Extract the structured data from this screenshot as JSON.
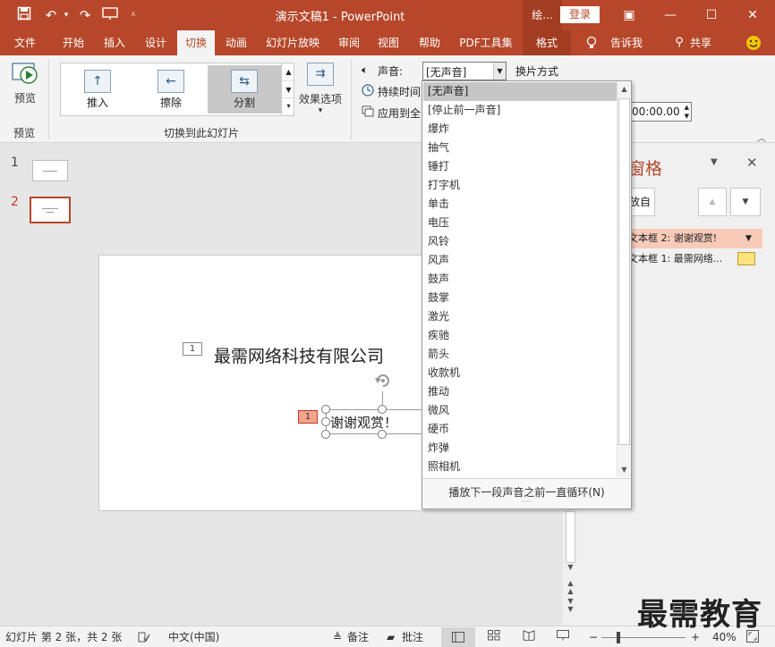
{
  "titlebar": {
    "title": "演示文稿1  -  PowerPoint",
    "context_tab": "绘...",
    "login": "登录",
    "save_icon": "save-icon",
    "undo_icon": "undo-icon",
    "redo_icon": "redo-icon",
    "minimize": "—",
    "maximize": "☐",
    "close": "✕",
    "ribbon_display": "▣"
  },
  "tabs": [
    {
      "label": "文件"
    },
    {
      "label": "开始"
    },
    {
      "label": "插入"
    },
    {
      "label": "设计"
    },
    {
      "label": "切换"
    },
    {
      "label": "动画"
    },
    {
      "label": "幻灯片放映"
    },
    {
      "label": "审阅"
    },
    {
      "label": "视图"
    },
    {
      "label": "帮助"
    },
    {
      "label": "PDF工具集"
    },
    {
      "label": "格式"
    },
    {
      "label": "告诉我"
    },
    {
      "label": "共享"
    }
  ],
  "ribbon": {
    "preview_label": "预览",
    "preview_group": "预览",
    "gallery_items": [
      {
        "label": "推入",
        "glyph": "↑"
      },
      {
        "label": "擦除",
        "glyph": "←"
      },
      {
        "label": "分割",
        "glyph": "⇆"
      }
    ],
    "transition_group": "切换到此幻灯片",
    "effect_options_line1": "效果选项",
    "effect_options_line2": "▾",
    "sound_label": "声音:",
    "sound_value": "[无声音]",
    "advance_label": "换片方式",
    "duration_label": "持续时间",
    "apply_all_label": "应用到全",
    "time_value": "00:00.00"
  },
  "thumbnails": [
    {
      "number": "1"
    },
    {
      "number": "2"
    }
  ],
  "slide": {
    "title_text": "最需网络科技有限公司",
    "title_tag": "1",
    "subtitle_text": "谢谢观赏！",
    "subtitle_tag": "1"
  },
  "anim_pane": {
    "title": "窗格",
    "play_label": "放自",
    "items": [
      {
        "label": "文本框 2: 谢谢观赏!"
      },
      {
        "label": "文本框 1: 最需网络..."
      }
    ]
  },
  "dropdown": {
    "items": [
      "[无声音]",
      "[停止前一声音]",
      "爆炸",
      "抽气",
      "锤打",
      "打字机",
      "单击",
      "电压",
      "风铃",
      "风声",
      "鼓声",
      "鼓掌",
      "激光",
      "疾驰",
      "箭头",
      "收款机",
      "推动",
      "微风",
      "硬币",
      "炸弹",
      "照相机"
    ],
    "selected_index": 0,
    "footer": "播放下一段声音之前一直循环(N)"
  },
  "statusbar": {
    "slide_info": "幻灯片 第 2 张，共 2 张",
    "language": "中文(中国)",
    "notes": "备注",
    "comments": "批注",
    "zoom": "40%",
    "zoom_fraction": 0.2
  },
  "watermark": "最需教育",
  "colors": {
    "accent": "#b7472a",
    "accent_dark": "#a33d22",
    "selected_item": "#c6c6c6",
    "anim_highlight": "#f8cbb9"
  }
}
